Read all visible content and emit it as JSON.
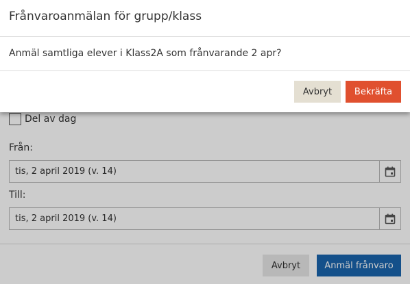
{
  "form": {
    "part_of_day_label": "Del av dag",
    "from_label": "Från:",
    "from_value": "tis, 2 april 2019 (v. 14)",
    "to_label": "Till:",
    "to_value": "tis, 2 april 2019 (v. 14)",
    "calendar_icon": "calendar-icon",
    "cancel_label": "Avbryt",
    "submit_label": "Anmäl frånvaro"
  },
  "dialog": {
    "title": "Frånvaroanmälan för grupp/klass",
    "message": "Anmäl samtliga elever i Klass2A som frånvarande 2 apr?",
    "cancel_label": "Avbryt",
    "confirm_label": "Bekräfta"
  },
  "colors": {
    "confirm": "#e0502f",
    "primary": "#1a65ad",
    "backdrop": "rgba(0,0,0,0.2)"
  }
}
